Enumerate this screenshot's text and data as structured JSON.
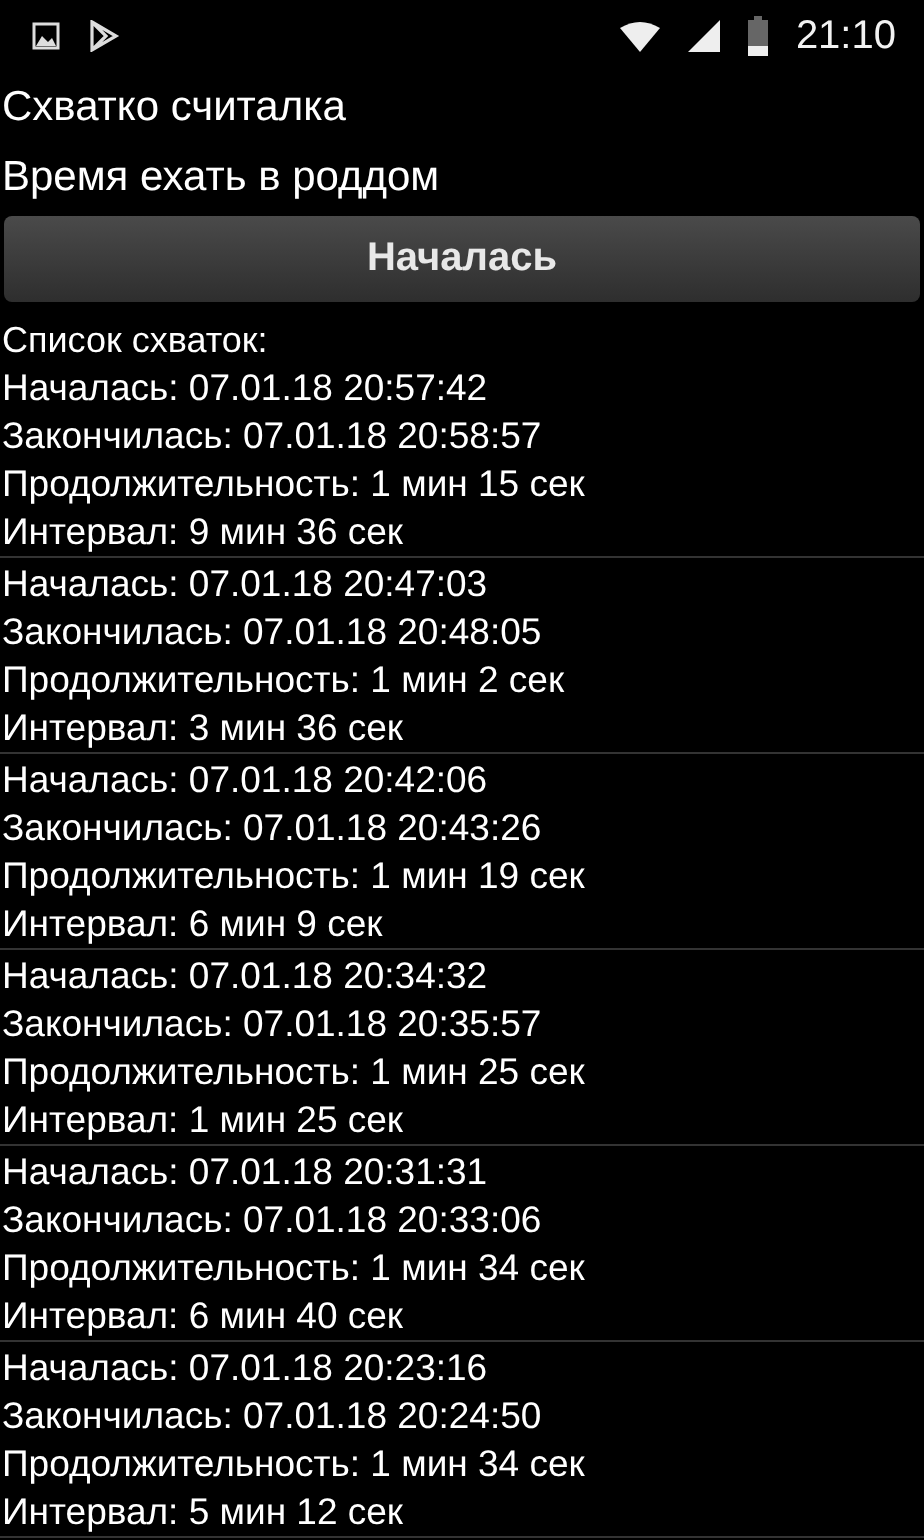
{
  "status_bar": {
    "time": "21:10"
  },
  "app_title": "Схватко считалка",
  "message": "Время ехать в роддом",
  "action_button": "Началась",
  "list_title": "Список схваток:",
  "contractions": [
    {
      "lines": [
        "Началась: 07.01.18 20:57:42",
        "Закончилась: 07.01.18 20:58:57",
        "Продолжительность: 1 мин 15 сек",
        "Интервал: 9 мин 36 сек"
      ]
    },
    {
      "lines": [
        "Началась: 07.01.18 20:47:03",
        "Закончилась: 07.01.18 20:48:05",
        "Продолжительность: 1 мин 2 сек",
        "Интервал: 3 мин 36 сек"
      ]
    },
    {
      "lines": [
        "Началась: 07.01.18 20:42:06",
        "Закончилась: 07.01.18 20:43:26",
        "Продолжительность: 1 мин 19 сек",
        "Интервал: 6 мин 9 сек"
      ]
    },
    {
      "lines": [
        "Началась: 07.01.18 20:34:32",
        "Закончилась: 07.01.18 20:35:57",
        "Продолжительность: 1 мин 25 сек",
        "Интервал: 1 мин 25 сек"
      ]
    },
    {
      "lines": [
        "Началась: 07.01.18 20:31:31",
        "Закончилась: 07.01.18 20:33:06",
        "Продолжительность: 1 мин 34 сек",
        "Интервал: 6 мин 40 сек"
      ]
    },
    {
      "lines": [
        "Началась: 07.01.18 20:23:16",
        "Закончилась: 07.01.18 20:24:50",
        "Продолжительность: 1 мин 34 сек",
        "Интервал: 5 мин 12 сек"
      ]
    }
  ]
}
